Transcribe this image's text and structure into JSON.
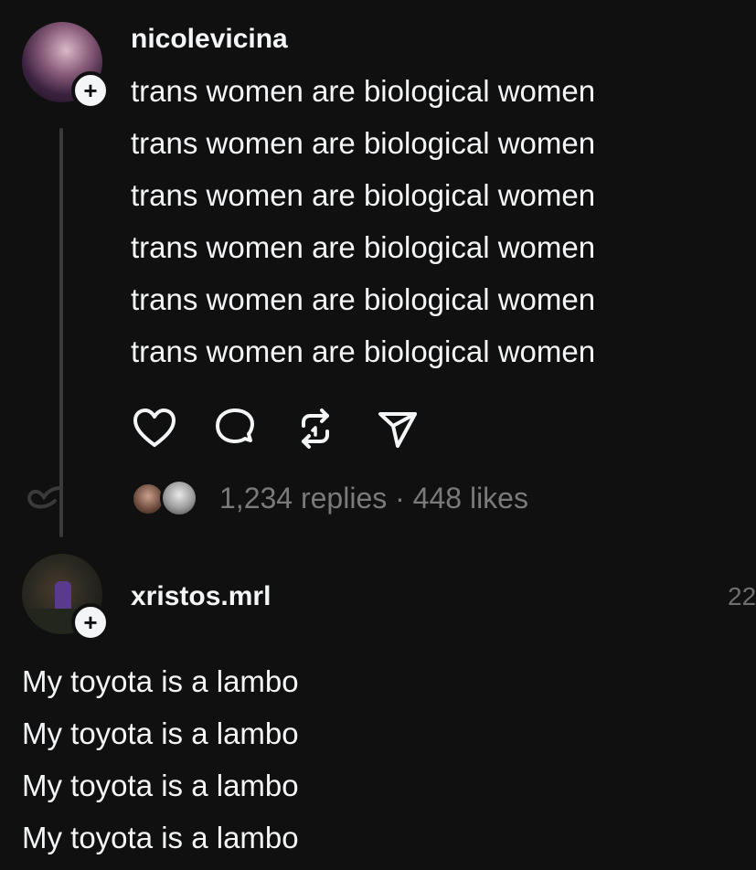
{
  "post": {
    "username": "nicolevicina",
    "lines": [
      "trans women are biological women",
      "trans women are biological women",
      "trans women are biological women",
      "trans women are biological women",
      "trans women are biological women",
      "trans women are biological women"
    ],
    "stats": "1,234 replies · 448 likes",
    "actions": [
      "heart-icon",
      "comment-icon",
      "repost-icon",
      "share-icon"
    ]
  },
  "reply": {
    "username": "xristos.mrl",
    "time": "22",
    "lines": [
      "My toyota is a lambo",
      "My toyota is a lambo",
      "My toyota is a lambo",
      "My toyota is a lambo"
    ]
  },
  "colors": {
    "background": "#101010",
    "text": "#f3f5f7",
    "muted": "#7a7a7a"
  }
}
